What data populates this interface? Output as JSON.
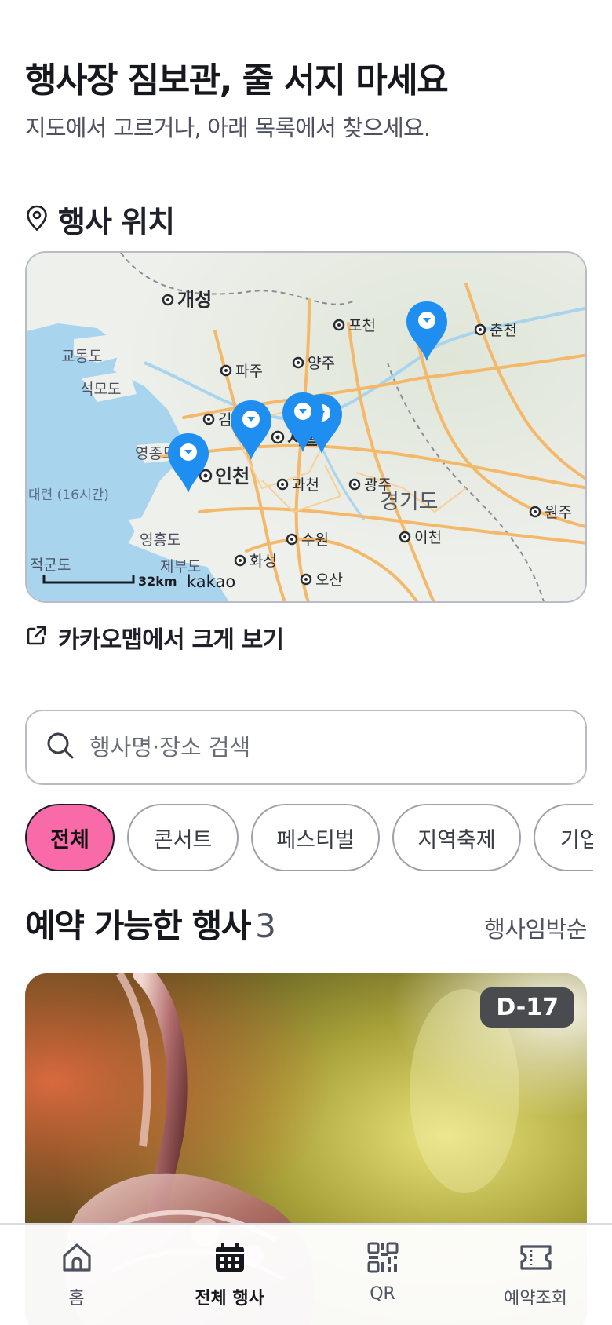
{
  "hero": {
    "title": "행사장 짐보관, 줄 서지 마세요",
    "subtitle": "지도에서 고르거나, 아래 목록에서 찾으세요."
  },
  "location_section": {
    "title": "행사 위치",
    "icon": "location-pin-icon"
  },
  "map": {
    "place_labels": [
      "개성",
      "포천",
      "춘천",
      "교동도",
      "파주",
      "양주",
      "석모도",
      "김포",
      "서울",
      "영종도",
      "인천",
      "과천",
      "광주",
      "경기도",
      "원주",
      "대련 (16시간)",
      "영흥도",
      "수원",
      "이천",
      "적군도",
      "제부도",
      "화성",
      "오산"
    ],
    "scale_label": "32km",
    "brand": "kakao",
    "marker_color": "#1f8ef1",
    "marker_count": 5
  },
  "map_link": {
    "label": "카카오맵에서 크게 보기",
    "icon": "external-link-icon"
  },
  "search": {
    "placeholder": "행사명·장소 검색",
    "value": ""
  },
  "filters": {
    "chips": [
      "전체",
      "콘서트",
      "페스티벌",
      "지역축제",
      "기업"
    ],
    "selected": "전체",
    "active_color": "#f86aa8"
  },
  "events_section": {
    "title": "예약 가능한 행사",
    "count": "3",
    "sort_label": "행사임박순"
  },
  "event_card": {
    "dday": "D-17"
  },
  "tabbar": {
    "tabs": [
      {
        "label": "홈",
        "icon": "home-icon"
      },
      {
        "label": "전체 행사",
        "icon": "calendar-icon"
      },
      {
        "label": "QR",
        "icon": "qr-code-icon"
      },
      {
        "label": "예약조회",
        "icon": "ticket-icon"
      }
    ],
    "active": "전체 행사"
  }
}
